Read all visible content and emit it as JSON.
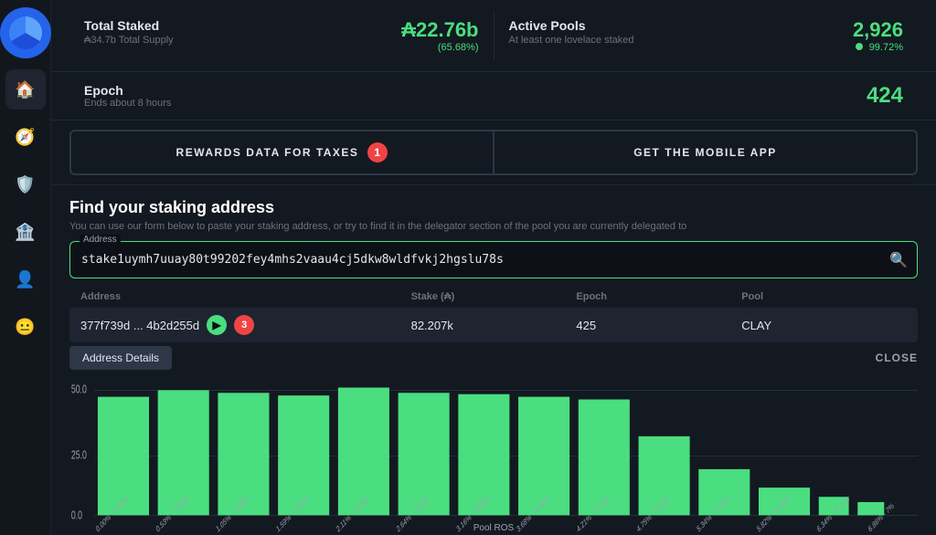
{
  "sidebar": {
    "items": [
      {
        "label": "Home",
        "icon": "🏠",
        "active": true
      },
      {
        "label": "Compass",
        "icon": "🧭",
        "active": false
      },
      {
        "label": "Shield",
        "icon": "🛡️",
        "active": false
      },
      {
        "label": "Bank",
        "icon": "🏦",
        "active": false
      },
      {
        "label": "User",
        "icon": "👤",
        "active": false
      },
      {
        "label": "Smiley",
        "icon": "😐",
        "active": false
      }
    ]
  },
  "stats": {
    "total_staked_label": "Total Staked",
    "total_staked_sublabel": "₳34.7b Total Supply",
    "total_staked_value": "₳22.76b",
    "total_staked_pct": "(65.68%)",
    "active_pools_label": "Active Pools",
    "active_pools_sublabel": "At least one lovelace staked",
    "active_pools_value": "2,926",
    "active_pools_pct": "99.72%",
    "epoch_label": "Epoch",
    "epoch_sublabel": "Ends about 8 hours",
    "epoch_value": "424"
  },
  "buttons": {
    "rewards_label": "REWARDS DATA FOR TAXES",
    "rewards_badge": "1",
    "mobile_label": "GET THE MOBILE APP"
  },
  "search": {
    "title": "Find your staking address",
    "description": "You can use our form below to paste your staking address, or try to find it in the delegator section of the pool you are currently delegated to",
    "address_label": "Address",
    "address_value": "stake1uymh7uuay80t99202fey4mhs2vaau4cj5dkw8wldfvkj2hgslu78s"
  },
  "table": {
    "columns": [
      "Address",
      "Stake (₳)",
      "Epoch",
      "Pool"
    ],
    "rows": [
      {
        "address": "377f739d ... 4b2d255d",
        "stake": "82.207k",
        "epoch": "425",
        "pool": "CLAY",
        "badge": "3"
      }
    ]
  },
  "address_details_btn": "Address Details",
  "close_btn": "CLOSE",
  "chart": {
    "y_max": 50.0,
    "y_mid": 25.0,
    "y_min": 0.0,
    "x_label": "Pool ROS",
    "bars": [
      {
        "label": "0.00% - 0.52%",
        "height": 0.82
      },
      {
        "label": "0.53% - 1.05%",
        "height": 0.9
      },
      {
        "label": "1.05% - 1.58%",
        "height": 0.88
      },
      {
        "label": "1.59% - 2.10%",
        "height": 0.85
      },
      {
        "label": "2.11% - 2.63%",
        "height": 0.92
      },
      {
        "label": "2.64% - 3.16%",
        "height": 0.88
      },
      {
        "label": "3.16% - 3.68%",
        "height": 0.86
      },
      {
        "label": "3.68% - 4.20%",
        "height": 0.84
      },
      {
        "label": "4.21% - 4.73%",
        "height": 0.82
      },
      {
        "label": "4.75% - 5.25%",
        "height": 0.45
      },
      {
        "label": "5.34% - 5.78%",
        "height": 0.2
      },
      {
        "label": "5.82% - 6.24%",
        "height": 0.12
      },
      {
        "label": "6.34% - 6.71%",
        "height": 0.08
      },
      {
        "label": "6.86% - 7%",
        "height": 0.06
      }
    ]
  }
}
